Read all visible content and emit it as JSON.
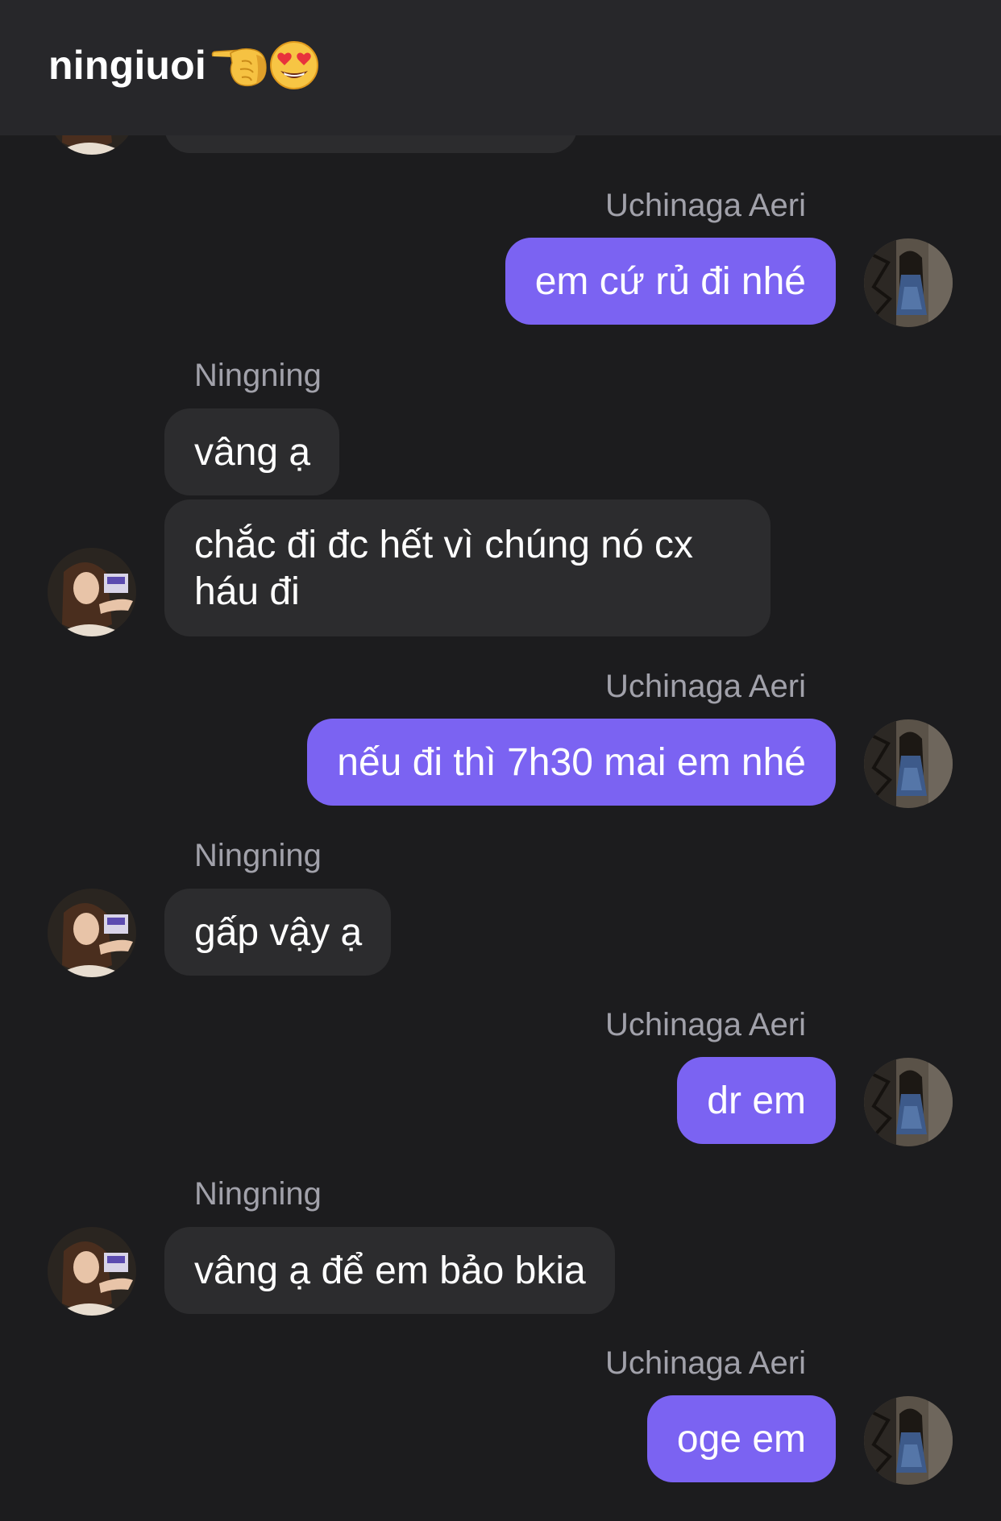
{
  "header": {
    "title": "ningiuoi",
    "title_emojis": [
      "backhand-pointing-left-emoji",
      "heart-eyes-emoji"
    ]
  },
  "colors": {
    "background": "#1c1c1e",
    "header_background": "#27272a",
    "outgoing_bubble": "#7b63f2",
    "incoming_bubble": "#2c2c2e",
    "sender_name": "#a1a1aa"
  },
  "messages": [
    {
      "direction": "out",
      "sender": "Uchinaga Aeri",
      "text": "em cứ rủ đi nhé"
    },
    {
      "direction": "in",
      "sender": "Ningning",
      "text": "vâng ạ"
    },
    {
      "direction": "in",
      "sender": "",
      "text": "chắc đi đc hết vì chúng nó cx háu đi"
    },
    {
      "direction": "out",
      "sender": "Uchinaga Aeri",
      "text": "nếu đi thì 7h30 mai em nhé"
    },
    {
      "direction": "in",
      "sender": "Ningning",
      "text": "gấp vậy ạ"
    },
    {
      "direction": "out",
      "sender": "Uchinaga Aeri",
      "text": "dr em"
    },
    {
      "direction": "in",
      "sender": "Ningning",
      "text": "vâng ạ để em bảo bkia"
    },
    {
      "direction": "out",
      "sender": "Uchinaga Aeri",
      "text": "oge em"
    }
  ]
}
